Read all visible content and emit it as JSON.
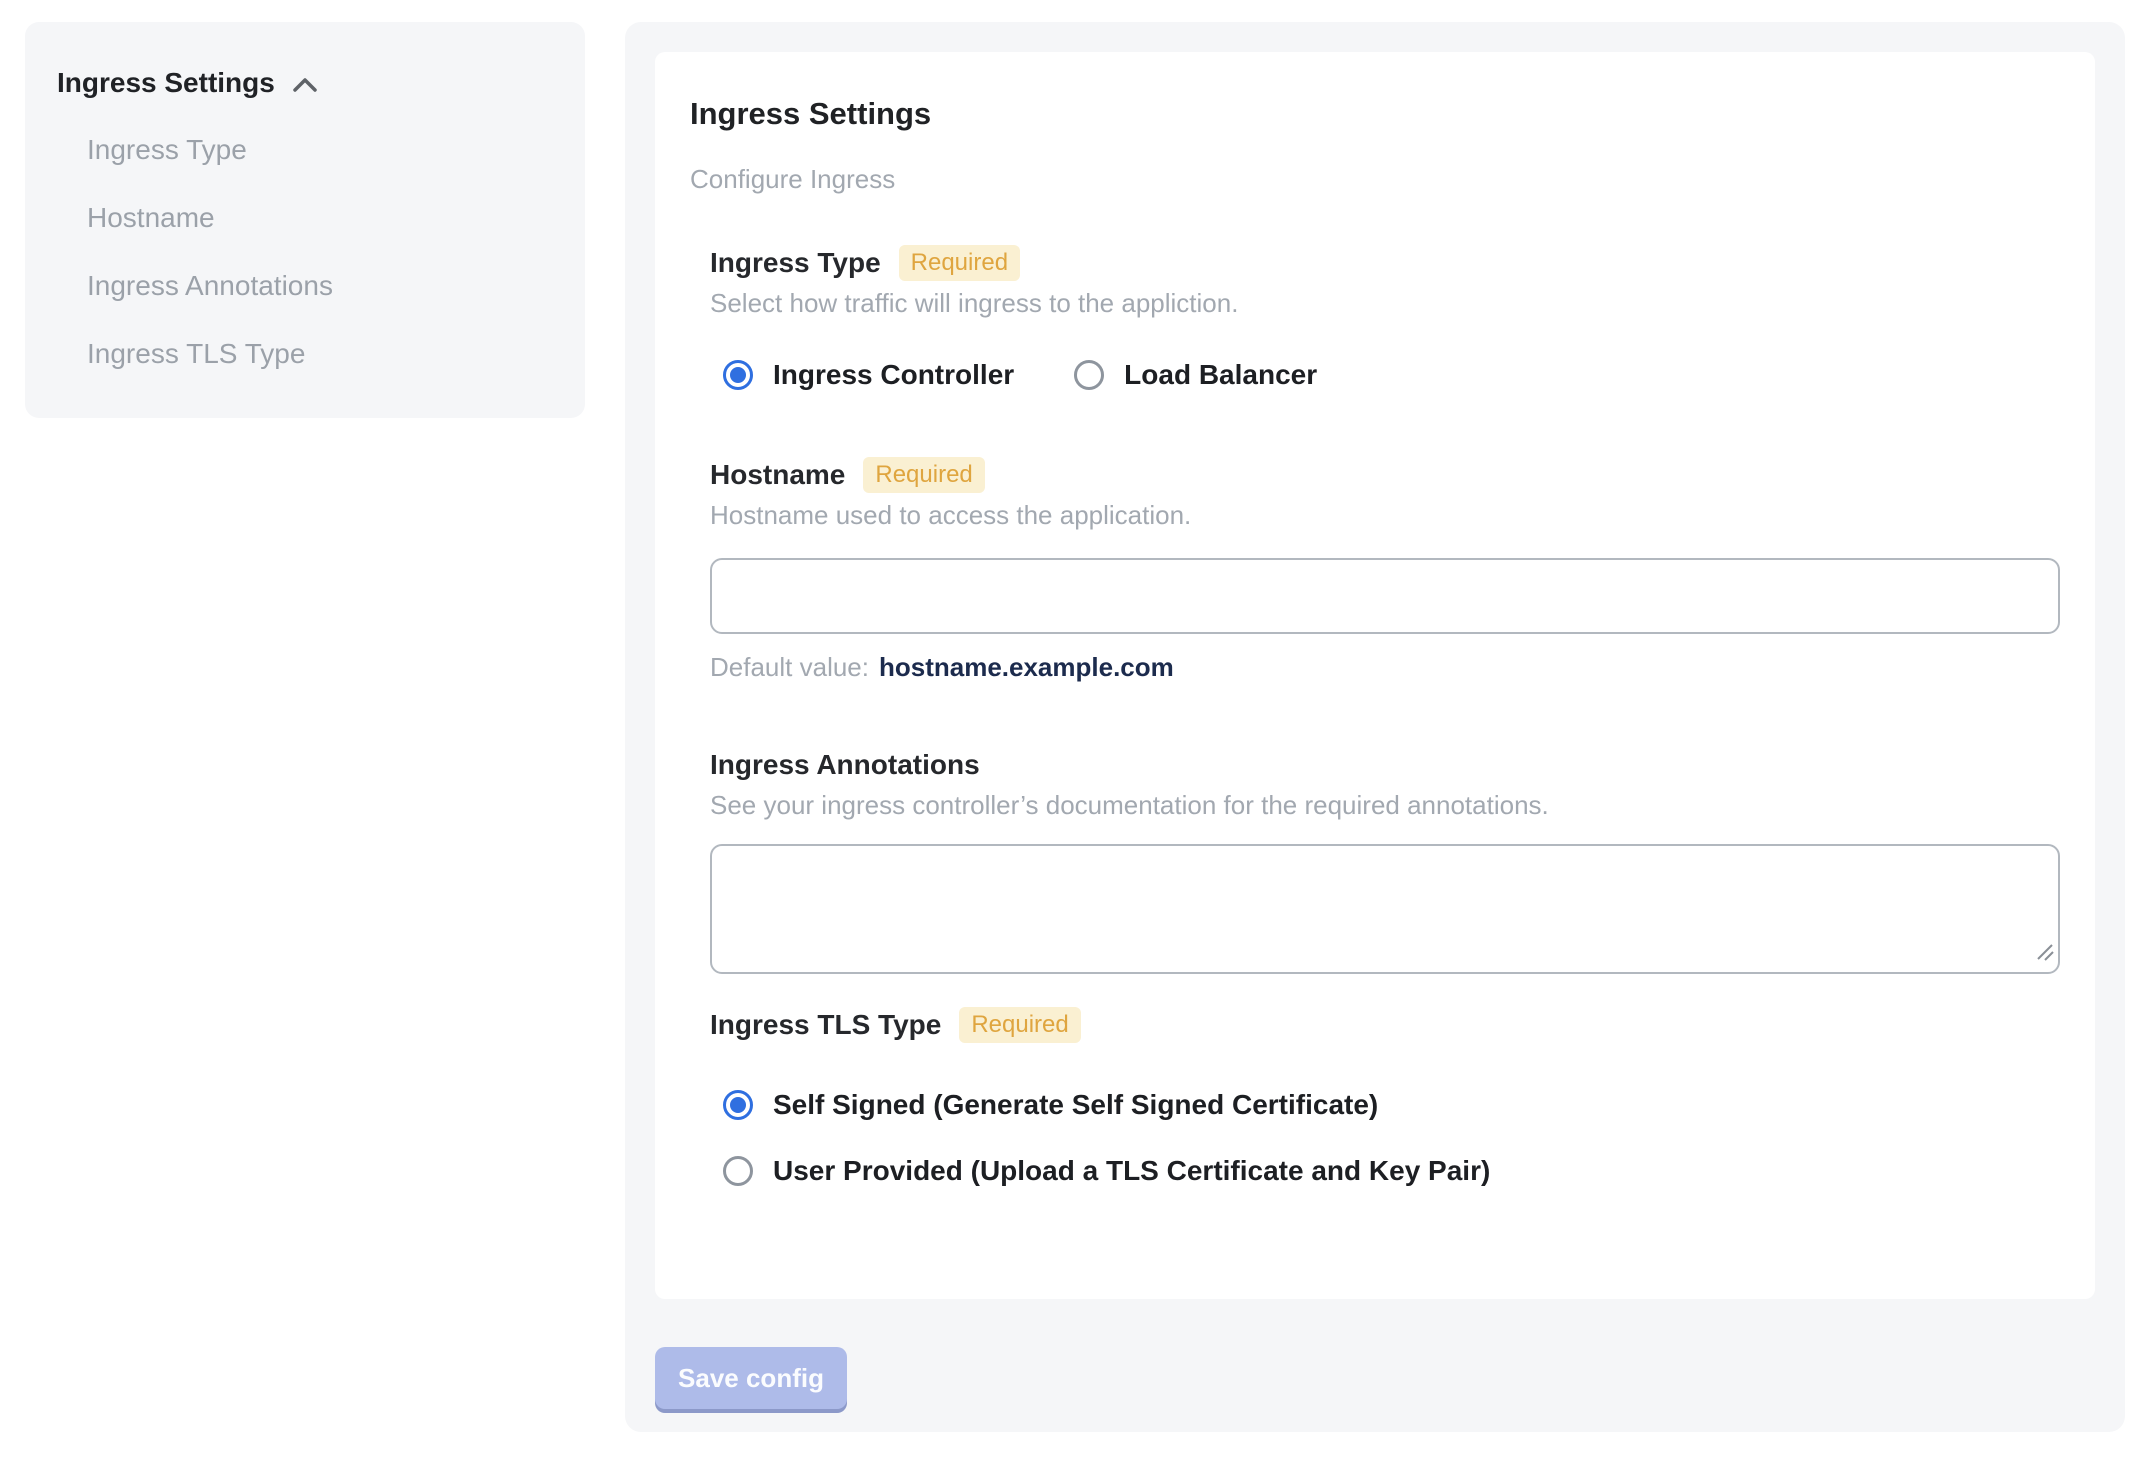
{
  "sidebar": {
    "header": {
      "label": "Ingress Settings",
      "chevron_icon": "chevron-up"
    },
    "items": [
      {
        "label": "Ingress Type"
      },
      {
        "label": "Hostname"
      },
      {
        "label": "Ingress Annotations"
      },
      {
        "label": "Ingress TLS Type"
      }
    ]
  },
  "panel": {
    "title": "Ingress Settings",
    "subtitle": "Configure Ingress",
    "sections": {
      "ingress_type": {
        "label": "Ingress Type",
        "required_badge": "Required",
        "description": "Select how traffic will ingress to the appliction.",
        "options": [
          {
            "label": "Ingress Controller",
            "selected": true
          },
          {
            "label": "Load Balancer",
            "selected": false
          }
        ]
      },
      "hostname": {
        "label": "Hostname",
        "required_badge": "Required",
        "description": "Hostname used to access the application.",
        "input_value": "",
        "default_value_label": "Default value:",
        "default_value": "hostname.example.com"
      },
      "annotations": {
        "label": "Ingress Annotations",
        "description": "See your ingress controller’s documentation for the required annotations.",
        "textarea_value": ""
      },
      "tls_type": {
        "label": "Ingress TLS Type",
        "required_badge": "Required",
        "options": [
          {
            "label": "Self Signed (Generate Self Signed Certificate)",
            "selected": true
          },
          {
            "label": "User Provided (Upload a TLS Certificate and Key Pair)",
            "selected": false
          }
        ]
      }
    },
    "save_button": "Save config"
  },
  "colors": {
    "panel_background": "#F5F6F8",
    "card_background": "#FFFFFF",
    "badge_background": "#FAF0D2",
    "badge_text": "#DFA53F",
    "radio_selected": "#2F6FE0",
    "default_value_text": "#1C2B4D",
    "save_button_background": "#AEBBE9",
    "muted_text": "#A2A8B0"
  }
}
